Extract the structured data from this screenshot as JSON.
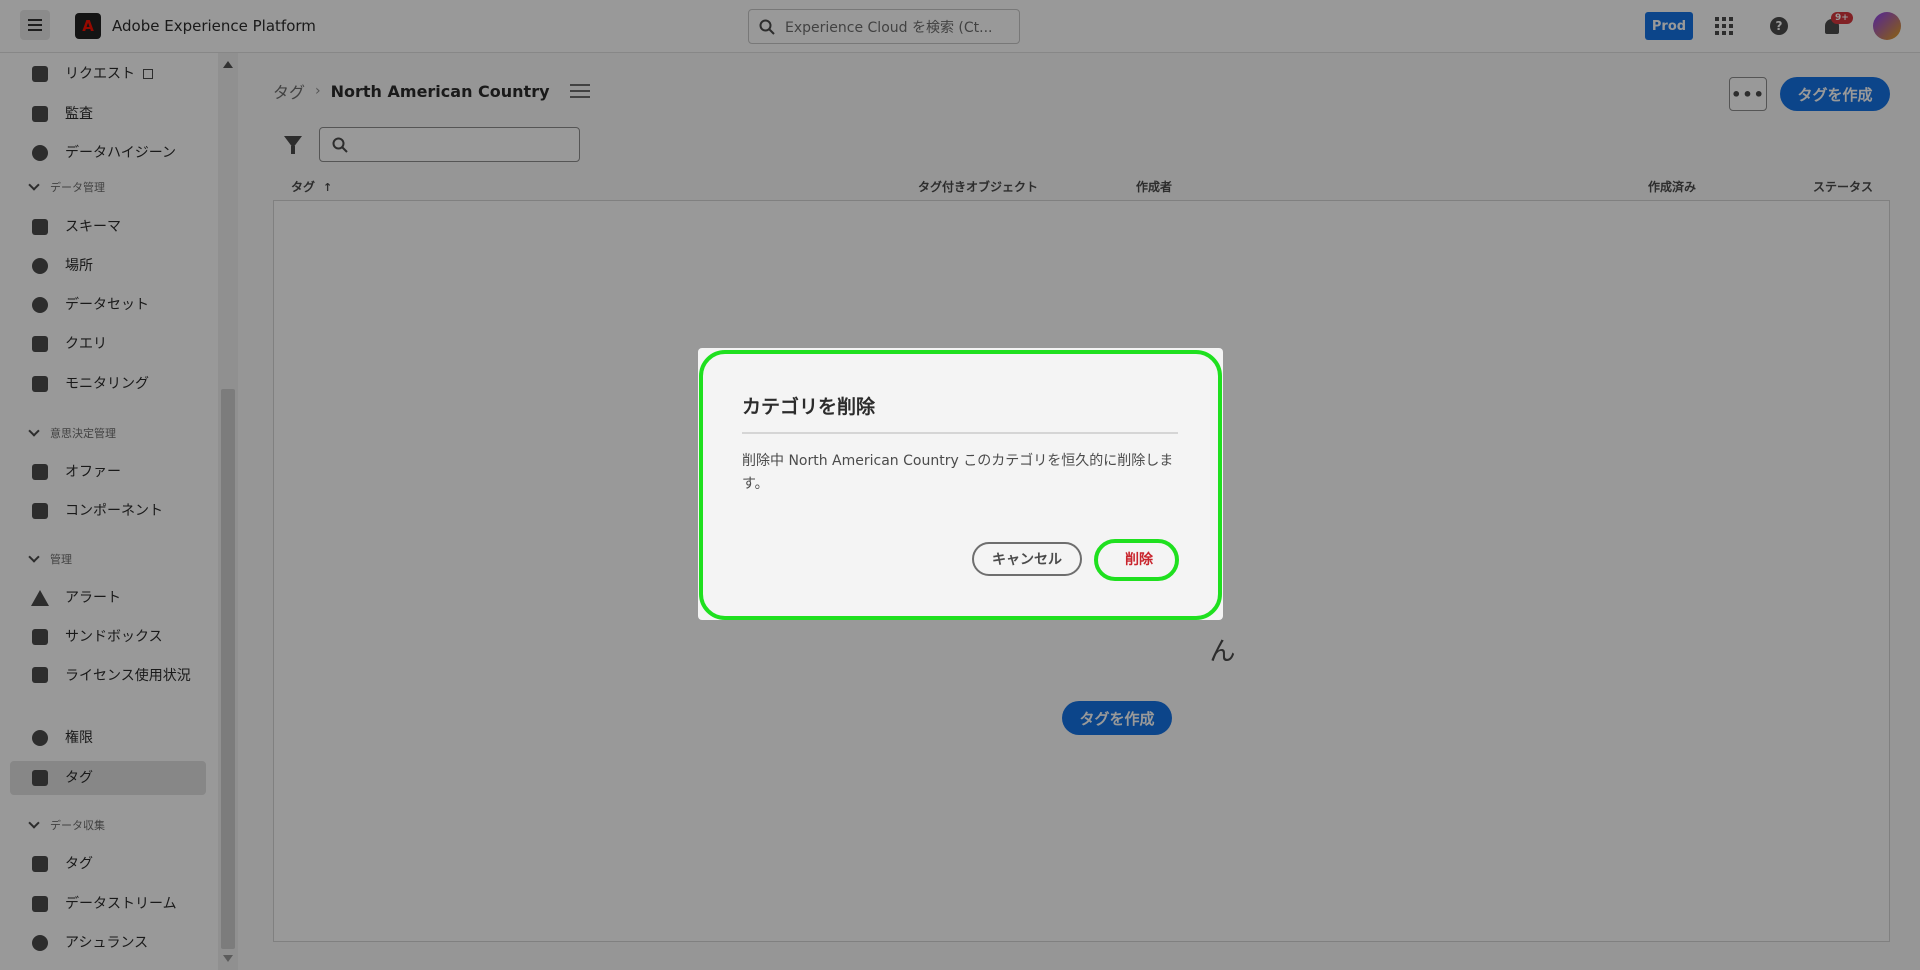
{
  "app": {
    "title": "Adobe Experience Platform"
  },
  "search": {
    "placeholder": "Experience Cloud を検索 (Ct..."
  },
  "header": {
    "env_badge": "Prod",
    "notification_count": "9+"
  },
  "sidebar": {
    "items": [
      {
        "label": "リクエスト",
        "icon": "request-icon"
      },
      {
        "label": "監査",
        "icon": "audit-icon"
      },
      {
        "label": "データハイジーン",
        "icon": "data-hygiene-icon"
      }
    ],
    "sections": [
      {
        "label": "データ管理",
        "items": [
          {
            "label": "スキーマ",
            "icon": "schema-icon"
          },
          {
            "label": "場所",
            "icon": "location-icon"
          },
          {
            "label": "データセット",
            "icon": "dataset-icon"
          },
          {
            "label": "クエリ",
            "icon": "query-icon"
          },
          {
            "label": "モニタリング",
            "icon": "monitoring-icon"
          }
        ]
      },
      {
        "label": "意思決定管理",
        "items": [
          {
            "label": "オファー",
            "icon": "offer-icon"
          },
          {
            "label": "コンポーネント",
            "icon": "component-icon"
          }
        ]
      },
      {
        "label": "管理",
        "items": [
          {
            "label": "アラート",
            "icon": "alert-icon"
          },
          {
            "label": "サンドボックス",
            "icon": "sandbox-icon"
          },
          {
            "label": "ライセンス使用状況",
            "icon": "license-icon"
          },
          {
            "label": "権限",
            "icon": "permissions-icon"
          },
          {
            "label": "タグ",
            "icon": "tag-icon",
            "active": true
          }
        ]
      },
      {
        "label": "データ収集",
        "items": [
          {
            "label": "タグ",
            "icon": "tags-launch-icon"
          },
          {
            "label": "データストリーム",
            "icon": "datastream-icon"
          },
          {
            "label": "アシュランス",
            "icon": "assurance-icon"
          }
        ]
      }
    ]
  },
  "main": {
    "breadcrumb": {
      "root": "タグ",
      "current": "North American Country"
    },
    "create_tag_label": "タグを作成",
    "more_label": "•••",
    "table": {
      "columns": [
        "タグ",
        "タグ付きオブジェクト",
        "作成者",
        "作成済み",
        "ステータス"
      ]
    },
    "empty_state": "ん"
  },
  "dialog": {
    "title": "カテゴリを削除",
    "body": "削除中 North American Country このカテゴリを恒久的に削除します。",
    "cancel_label": "キャンセル",
    "delete_label": "削除"
  },
  "colors": {
    "accent": "#1473e6",
    "highlight": "#1fe01f",
    "danger": "#c9252d"
  }
}
